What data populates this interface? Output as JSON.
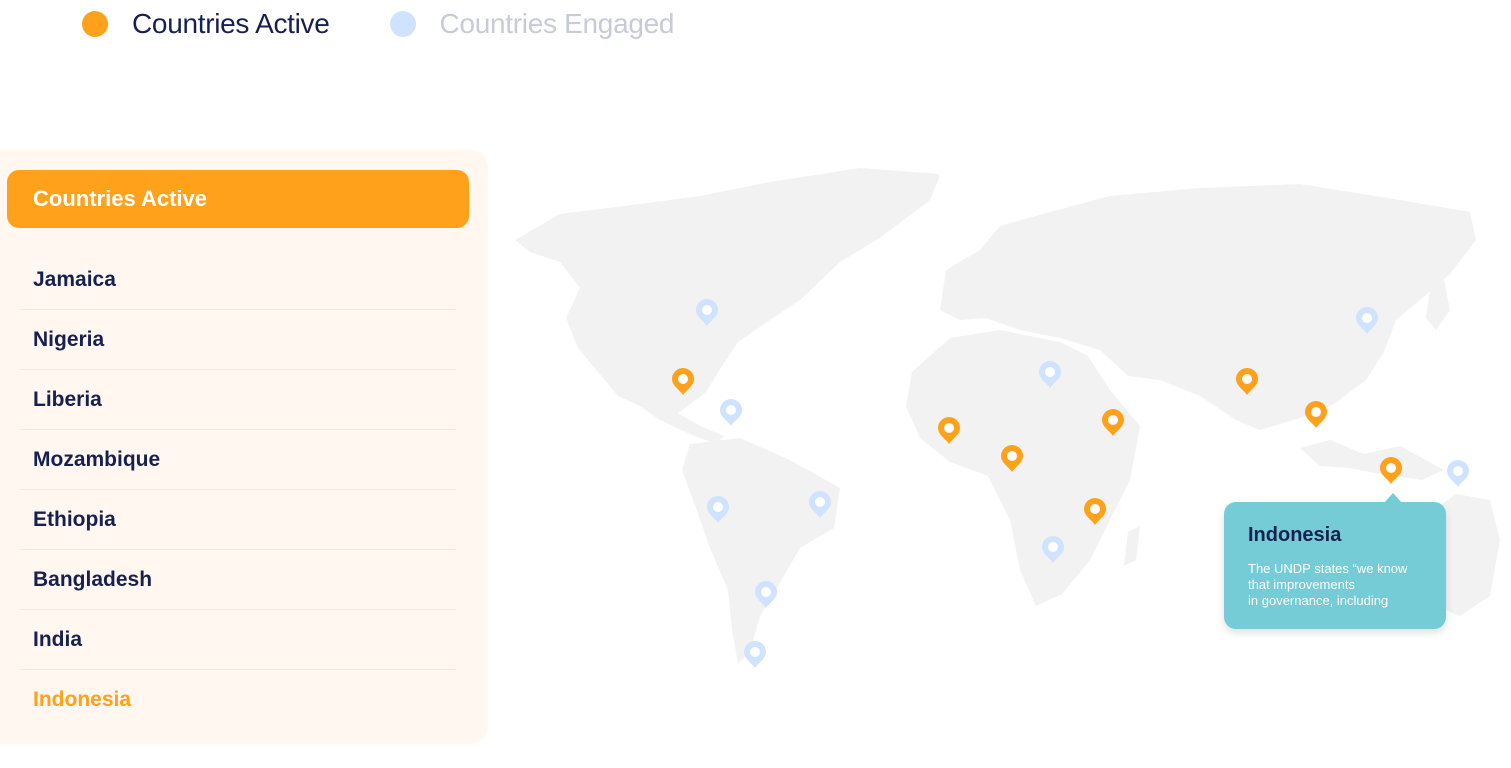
{
  "legend": {
    "active_label": "Countries Active",
    "engaged_label": "Countries Engaged"
  },
  "panel": {
    "header": "Countries Active",
    "countries": [
      "Jamaica",
      "Nigeria",
      "Liberia",
      "Mozambique",
      "Ethiopia",
      "Bangladesh",
      "India",
      "Indonesia"
    ],
    "selected": "Indonesia"
  },
  "tooltip": {
    "title": "Indonesia",
    "body": "The UNDP states “we know\nthat improvements\nin governance, including"
  },
  "colors": {
    "active": "#ffa11a",
    "engaged": "#cfe3ff",
    "map_land": "#f2f2f2",
    "tooltip": "#75ccd6",
    "navy": "#17214f"
  },
  "markers": {
    "active_count": 8,
    "engaged_count": 10
  }
}
